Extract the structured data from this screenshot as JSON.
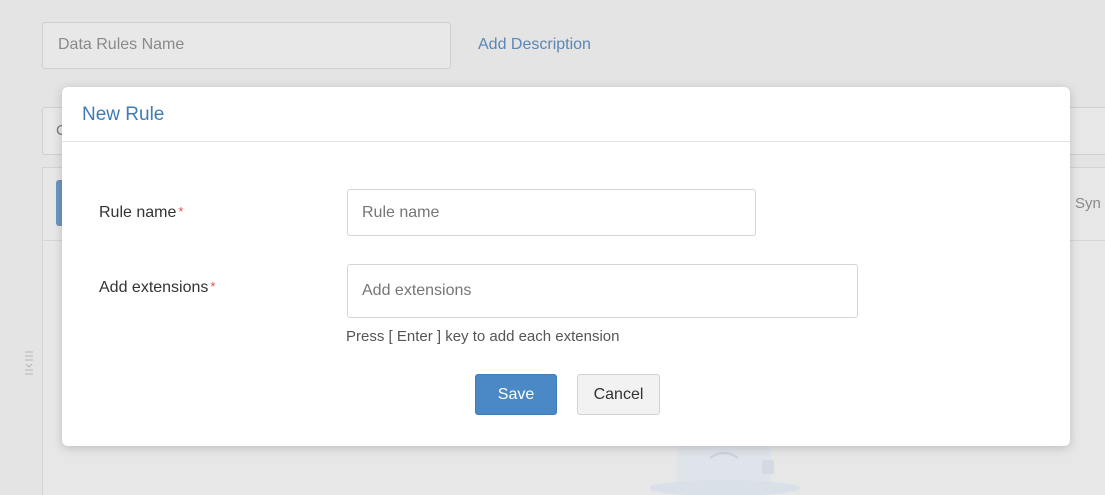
{
  "background": {
    "name_placeholder": "Data Rules Name",
    "add_description_label": "Add Description",
    "row2_fragment": "C",
    "syn_fragment": "Syn"
  },
  "modal": {
    "title": "New Rule",
    "rule_name": {
      "label": "Rule name",
      "required_mark": "*",
      "value": "",
      "placeholder": "Rule name"
    },
    "extensions": {
      "label": "Add extensions",
      "required_mark": "*",
      "value": "",
      "placeholder": "Add extensions",
      "help": "Press [ Enter ] key to add each extension"
    },
    "buttons": {
      "save": "Save",
      "cancel": "Cancel"
    }
  },
  "colors": {
    "accent": "#4a89c6",
    "title": "#3f7bb6",
    "required": "#d9534f"
  }
}
